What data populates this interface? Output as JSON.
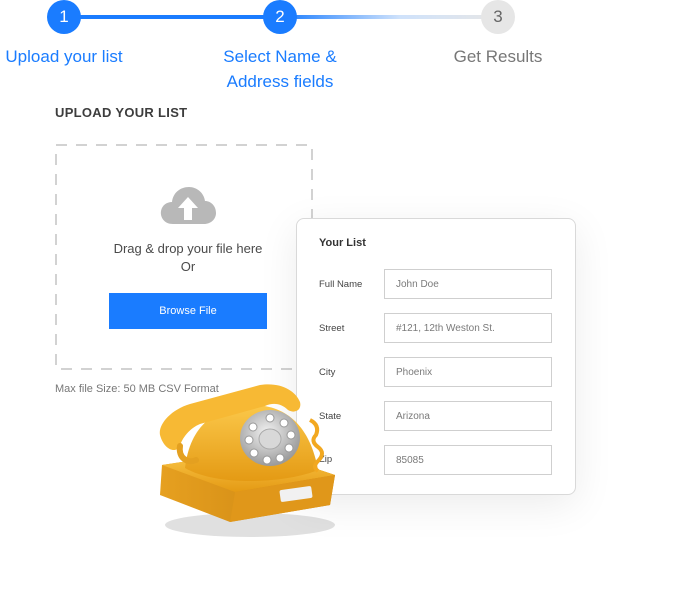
{
  "stepper": {
    "steps": [
      {
        "number": "1",
        "label": "Upload your list",
        "state": "done"
      },
      {
        "number": "2",
        "label_line1": "Select Name &",
        "label_line2": "Address fields",
        "state": "active"
      },
      {
        "number": "3",
        "label": "Get Results",
        "state": "pending"
      }
    ],
    "colors": {
      "active": "#1a7cff",
      "inactive": "#e2e2e2",
      "active_text": "#1a7cff",
      "inactive_text": "#7a7a7a"
    }
  },
  "upload": {
    "title": "UPLOAD YOUR LIST",
    "drag_text": "Drag & drop your file here",
    "or_text": "Or",
    "browse_label": "Browse File",
    "max_size": "Max file Size: 50 MB CSV Format",
    "icon": "cloud-upload-icon"
  },
  "form": {
    "title": "Your List",
    "fields": [
      {
        "label": "Full Name",
        "value": "John Doe"
      },
      {
        "label": "Street",
        "value": "#121, 12th Weston St."
      },
      {
        "label": "City",
        "value": "Phoenix"
      },
      {
        "label": "State",
        "value": "Arizona"
      },
      {
        "label": "Zip",
        "value": "85085"
      }
    ]
  },
  "illustration": {
    "icon": "rotary-telephone-icon",
    "color": "#f6b42c"
  }
}
